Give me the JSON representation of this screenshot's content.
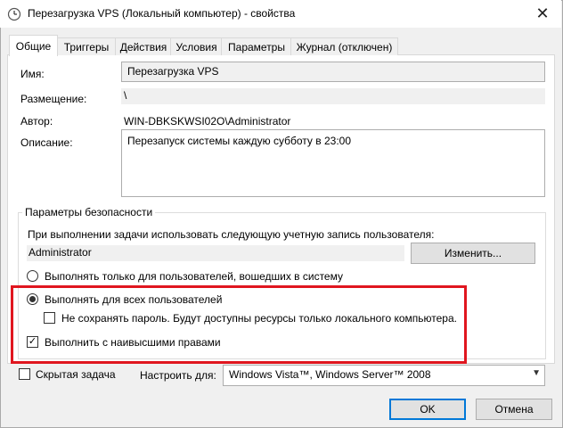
{
  "window": {
    "title": "Перезагрузка VPS (Локальный компьютер) - свойства",
    "close_glyph": "✕"
  },
  "tabs": [
    {
      "label": "Общие"
    },
    {
      "label": "Триггеры"
    },
    {
      "label": "Действия"
    },
    {
      "label": "Условия"
    },
    {
      "label": "Параметры"
    },
    {
      "label": "Журнал (отключен)"
    }
  ],
  "general": {
    "name_label": "Имя:",
    "name_value": "Перезагрузка VPS",
    "location_label": "Размещение:",
    "location_value": "\\",
    "author_label": "Автор:",
    "author_value": "WIN-DBKSKWSI02O\\Administrator",
    "description_label": "Описание:",
    "description_value": "Перезапуск системы каждую субботу в 23:00"
  },
  "security": {
    "group_title": "Параметры безопасности",
    "account_prompt": "При выполнении задачи использовать следующую учетную запись пользователя:",
    "account_value": "Administrator",
    "change_button": "Изменить...",
    "radio_logged_on": "Выполнять только для пользователей, вошедших в систему",
    "radio_all_users": "Выполнять для всех пользователей",
    "checkbox_no_password": "Не сохранять пароль. Будут доступны ресурсы только локального компьютера.",
    "checkbox_highest": "Выполнить с наивысшими правами"
  },
  "bottom": {
    "hidden_label": "Скрытая задача",
    "configure_label": "Настроить для:",
    "configure_value": "Windows Vista™, Windows Server™ 2008",
    "ok_button": "OK",
    "cancel_button": "Отмена"
  },
  "state": {
    "radio_selected": "all_users",
    "no_password_checked": false,
    "highest_checked": true,
    "hidden_checked": false
  },
  "colors": {
    "highlight_box": "#e0161f",
    "default_button_border": "#0078d7"
  }
}
